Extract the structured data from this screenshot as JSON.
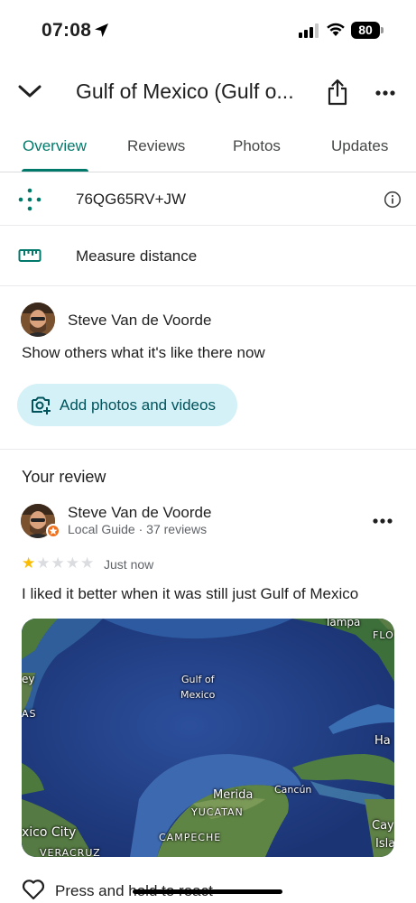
{
  "status": {
    "time": "07:08",
    "battery": "80"
  },
  "header": {
    "title": "Gulf of Mexico (Gulf o..."
  },
  "tabs": [
    {
      "label": "Overview",
      "active": true
    },
    {
      "label": "Reviews",
      "active": false
    },
    {
      "label": "Photos",
      "active": false
    },
    {
      "label": "Updates",
      "active": false
    }
  ],
  "details": {
    "plus_code": "76QG65RV+JW",
    "measure_label": "Measure distance"
  },
  "add_photos": {
    "user_name": "Steve Van de Voorde",
    "prompt": "Show others what it's like there now",
    "button_label": "Add photos and videos"
  },
  "review": {
    "heading": "Your review",
    "user_name": "Steve Van de Voorde",
    "user_meta": "Local Guide · 37 reviews",
    "rating": 1,
    "rating_max": 5,
    "time": "Just now",
    "text": "I liked it better when it was still just Gulf of Mexico",
    "photo_labels": {
      "tampa": "Tampa",
      "flo": "FLO",
      "gulf": "Gulf of",
      "mexico": "Mexico",
      "ey": "ey",
      "as": "AS",
      "ha": "Ha",
      "cancun": "Cancún",
      "merida": "Merida",
      "yucatan": "YUCATAN",
      "campeche": "CAMPECHE",
      "mexico_city": "xico City",
      "veracruz": "VERACRUZ",
      "cay": "Cay",
      "isl": "Isla"
    },
    "react_label": "Press and hold to react"
  },
  "colors": {
    "accent": "#00796b",
    "chip_bg": "#d3f1f7",
    "star_filled": "#fbbc04",
    "star_empty": "#dadce0",
    "guide_badge": "#f0701c"
  }
}
